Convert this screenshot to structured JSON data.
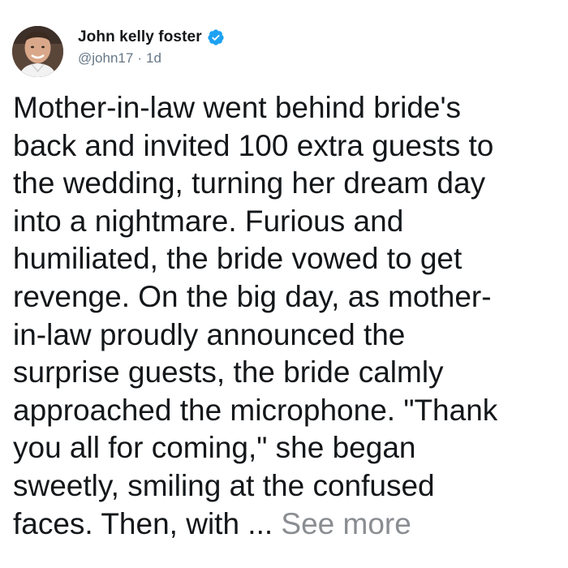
{
  "author": {
    "display_name": "John kelly foster",
    "handle": "@john17",
    "separator": "·",
    "time_ago": "1d",
    "verified_icon": "verified-badge-icon",
    "verified_color": "#1da1f2"
  },
  "tweet": {
    "text": "Mother-in-law went behind bride's\nback and invited 100 extra guests to\nthe wedding, turning her dream day\ninto a nightmare. Furious and\nhumiliated, the bride vowed to get\nrevenge. On the big day, as mother-\nin-law proudly announced the\nsurprise guests, the bride calmly\napproached the microphone. \"Thank\nyou all for coming,\" she began\nsweetly, smiling at the confused\nfaces. Then, with ...",
    "see_more_label": "See more"
  }
}
